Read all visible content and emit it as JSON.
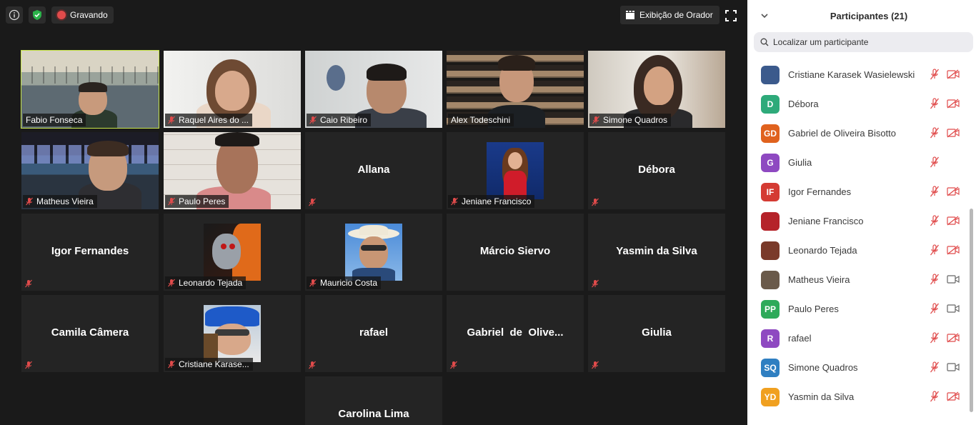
{
  "topbar": {
    "recording_label": "Gravando",
    "speaker_view_label": "Exibição de Orador"
  },
  "tiles": [
    {
      "name": "Fabio Fonseca",
      "type": "video",
      "active": true
    },
    {
      "name": "Raquel Aires do ...",
      "type": "video"
    },
    {
      "name": "Caio Ribeiro",
      "type": "video"
    },
    {
      "name": "Alex Todeschini",
      "type": "video"
    },
    {
      "name": "Simone Quadros",
      "type": "video"
    },
    {
      "name": "Matheus Vieira",
      "type": "video"
    },
    {
      "name": "Paulo Peres",
      "type": "video"
    },
    {
      "name": "Allana",
      "type": "name"
    },
    {
      "name": "Jeniane Francisco",
      "type": "avatar"
    },
    {
      "name": "Débora",
      "type": "name"
    },
    {
      "name": "Igor Fernandes",
      "type": "name"
    },
    {
      "name": "Leonardo Tejada",
      "type": "avatar"
    },
    {
      "name": "Mauricio Costa",
      "type": "avatar"
    },
    {
      "name": "Márcio Siervo",
      "type": "name"
    },
    {
      "name": "Yasmin da Silva",
      "type": "name"
    },
    {
      "name": "Camila Câmera",
      "type": "name"
    },
    {
      "name": "Cristiane Karase...",
      "type": "avatar"
    },
    {
      "name": "rafael",
      "type": "name"
    },
    {
      "name": "Gabriel  de  Olive...",
      "type": "name"
    },
    {
      "name": "Giulia",
      "type": "name"
    },
    {
      "name": "Carolina Lima",
      "type": "name"
    }
  ],
  "panel": {
    "title": "Participantes (21)",
    "search_placeholder": "Localizar um participante",
    "participants": [
      {
        "name": "Cristiane Karasek Wasielewski",
        "initials": "",
        "color": "#3b5a8c",
        "camera": "off"
      },
      {
        "name": "Débora",
        "initials": "D",
        "color": "#2eaa7a",
        "camera": "off"
      },
      {
        "name": "Gabriel de Oliveira Bisotto",
        "initials": "GD",
        "color": "#e0621e",
        "camera": "off"
      },
      {
        "name": "Giulia",
        "initials": "G",
        "color": "#8e49c1",
        "camera": "none"
      },
      {
        "name": "Igor Fernandes",
        "initials": "IF",
        "color": "#d43b33",
        "camera": "off"
      },
      {
        "name": "Jeniane Francisco",
        "initials": "",
        "color": "#b5232a",
        "camera": "off"
      },
      {
        "name": "Leonardo Tejada",
        "initials": "",
        "color": "#7a3a2a",
        "camera": "off"
      },
      {
        "name": "Matheus Vieira",
        "initials": "",
        "color": "#6a5a4a",
        "camera": "on"
      },
      {
        "name": "Paulo Peres",
        "initials": "PP",
        "color": "#2eaa5a",
        "camera": "on"
      },
      {
        "name": "rafael",
        "initials": "R",
        "color": "#8e49c1",
        "camera": "off"
      },
      {
        "name": "Simone Quadros",
        "initials": "SQ",
        "color": "#2f7fc1",
        "camera": "on"
      },
      {
        "name": "Yasmin da Silva",
        "initials": "YD",
        "color": "#f0a020",
        "camera": "off"
      }
    ]
  }
}
